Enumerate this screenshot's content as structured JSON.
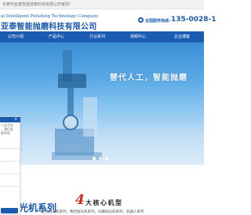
{
  "topbar": {
    "text": "东莞市亚泰智能抛磨科技有限公司官网！"
  },
  "header": {
    "logo_en": "al Intelligent Polishing Technology Company",
    "logo_cn": "亚泰智能抛磨科技有限公司",
    "hotline_label": "全国服务热线:",
    "hotline_number": "135-0028-1"
  },
  "nav": {
    "items": [
      {
        "label": "公司介绍"
      },
      {
        "label": "产品中心"
      },
      {
        "label": "行业系列"
      },
      {
        "label": "视频中心"
      },
      {
        "label": "企业博客"
      }
    ]
  },
  "banner": {
    "slogan": "替代人工，智能抛磨"
  },
  "section": {
    "number": "4",
    "title_rest": "大核心机型",
    "subtitle": "磨性抛光机系列，数控抛光机系列，伺服抛光机系列，机器人系列"
  },
  "bottom": {
    "title": "光机系列"
  },
  "chat": {
    "close": "×",
    "lines": [
      "人员不在",
      "，我们会",
      "联系您"
    ]
  },
  "colors": {
    "brand": "#1b5cb3",
    "accent": "#d42a1f"
  },
  "icons": {
    "phone": "phone-icon",
    "close": "close-icon"
  }
}
